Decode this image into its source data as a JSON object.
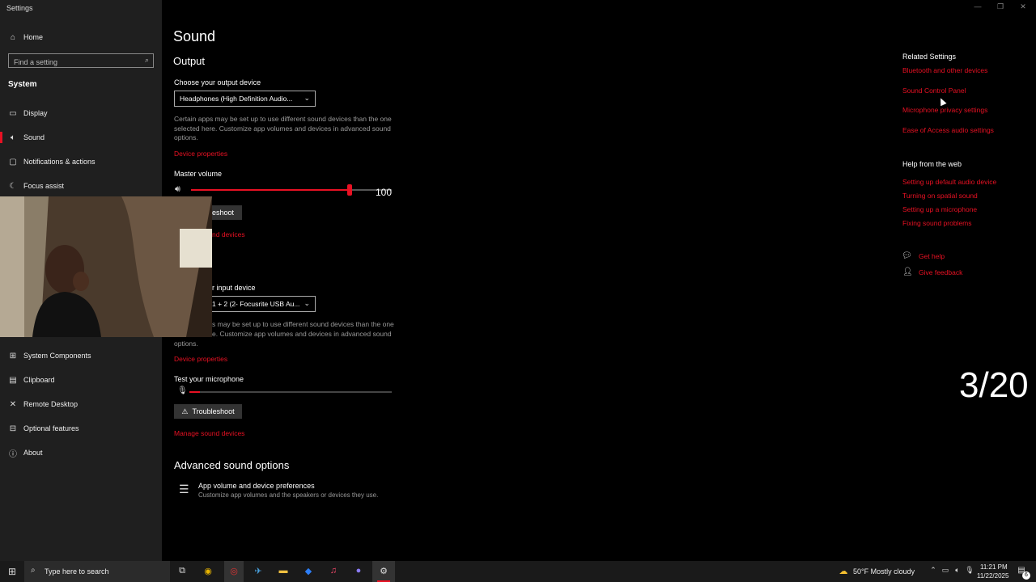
{
  "window": {
    "title": "Settings",
    "minimize": "—",
    "maximize": "❐",
    "close": "✕"
  },
  "sidebar": {
    "home": "Home",
    "search_placeholder": "Find a setting",
    "section": "System",
    "items": [
      {
        "label": "Display",
        "icon": "display-icon"
      },
      {
        "label": "Sound",
        "icon": "speaker-icon"
      },
      {
        "label": "Notifications & actions",
        "icon": "notification-icon"
      },
      {
        "label": "Focus assist",
        "icon": "moon-icon"
      },
      {
        "label": "System Components",
        "icon": "components-icon"
      },
      {
        "label": "Clipboard",
        "icon": "clipboard-icon"
      },
      {
        "label": "Remote Desktop",
        "icon": "remote-desktop-icon"
      },
      {
        "label": "Optional features",
        "icon": "optional-features-icon"
      },
      {
        "label": "About",
        "icon": "info-icon"
      }
    ]
  },
  "main": {
    "title": "Sound",
    "output": {
      "heading": "Output",
      "choose_label": "Choose your output device",
      "device": "Headphones (High Definition Audio...",
      "description": "Certain apps may be set up to use different sound devices than the one selected here. Customize app volumes and devices in advanced sound options.",
      "device_properties": "Device properties",
      "master_volume_label": "Master volume",
      "master_volume_value": "100",
      "master_volume_level": 1.0,
      "troubleshoot": "leshoot",
      "manage_devices": "nd devices"
    },
    "input": {
      "choose_label": "r input device",
      "device": "1 + 2 (2- Focusrite USB Au...",
      "description_line1": "s may be set up to use different sound devices than the one",
      "description_line2": "e. Customize app volumes and devices in advanced sound",
      "description_line3": "options.",
      "device_properties": "Device properties",
      "test_label": "Test your microphone",
      "mic_level": 0.05,
      "troubleshoot": "Troubleshoot",
      "manage_devices": "Manage sound devices"
    },
    "advanced": {
      "heading": "Advanced sound options",
      "item_title": "App volume and device preferences",
      "item_desc": "Customize app volumes and the speakers or devices they use."
    }
  },
  "related": {
    "heading": "Related Settings",
    "links": [
      "Bluetooth and other devices",
      "Sound Control Panel",
      "Microphone privacy settings",
      "Ease of Access audio settings"
    ],
    "help_heading": "Help from the web",
    "help_links": [
      "Setting up default audio device",
      "Turning on spatial sound",
      "Setting up a microphone",
      "Fixing sound problems"
    ],
    "get_help": "Get help",
    "give_feedback": "Give feedback"
  },
  "overlay": {
    "counter": "3/20"
  },
  "taskbar": {
    "search_placeholder": "Type here to search",
    "weather": "50°F  Mostly cloudy",
    "time": "11:21 PM",
    "date": "11/22/2025",
    "notification_count": "6"
  },
  "colors": {
    "accent": "#e81123",
    "sidebar_bg": "#1f1f1f",
    "main_bg": "#000000"
  }
}
